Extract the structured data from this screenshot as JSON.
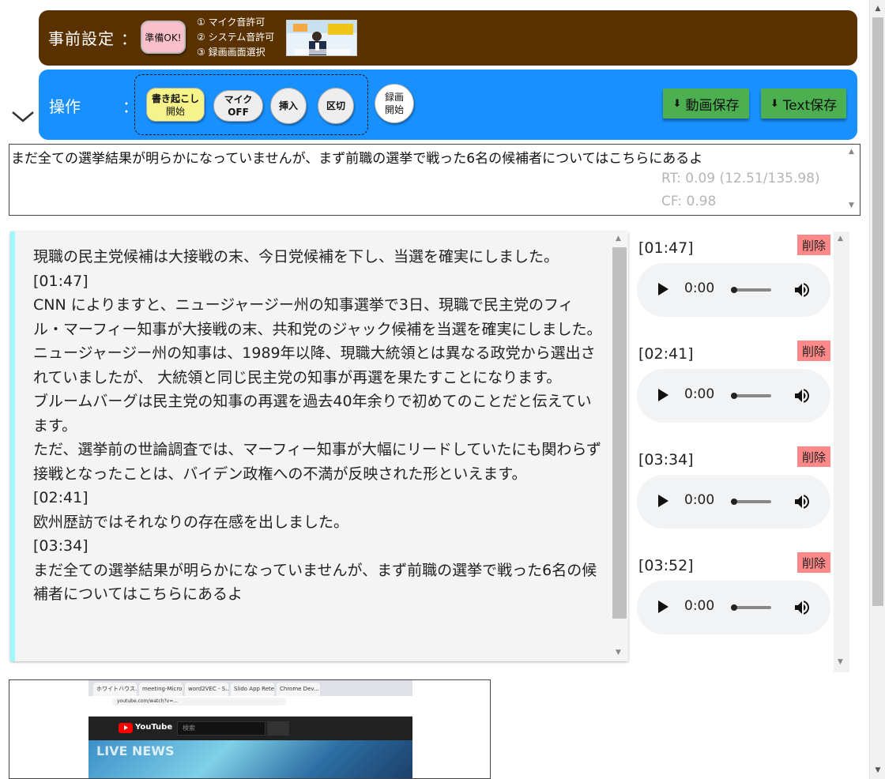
{
  "prep": {
    "title": "事前設定",
    "colon": "：",
    "ready_button": "準備OK!",
    "steps": [
      "① マイク音許可",
      "② システム音許可",
      "③ 録画画面選択"
    ]
  },
  "ops": {
    "title": "操作",
    "colon": "：",
    "transcribe_button": [
      "書き起こし",
      "開始"
    ],
    "mic_button": [
      "マイク",
      "OFF"
    ],
    "insert_button": "挿入",
    "split_button": "区切",
    "record_button": [
      "録画",
      "開始"
    ],
    "save_video_button": "動画保存",
    "save_text_button": "Text保存"
  },
  "live": {
    "text": "まだ全ての選挙結果が明らかになっていませんが、まず前職の選挙で戦った6名の候補者についてはこちらにあるよ",
    "rt": "RT: 0.09 (12.51/135.98)",
    "cf": "CF: 0.98"
  },
  "transcript": {
    "text": "現職の民主党候補は大接戦の末、今日党候補を下し、当選を確実にしました。\n[01:47]\nCNN によりますと、ニュージャージー州の知事選挙で3日、現職で民主党のフィル・マーフィー知事が大接戦の末、共和党のジャック候補を当選を確実にしました。\nニュージャージー州の知事は、1989年以降、現職大統領とは異なる政党から選出されていましたが、 大統領と同じ民主党の知事が再選を果たすことになります。\nブルームバーグは民主党の知事の再選を過去40年余りで初めてのことだと伝えています。\nただ、選挙前の世論調査では、マーフィー知事が大幅にリードしていたにも関わらず接戦となったことは、バイデン政権への不満が反映された形といえます。\n[02:41]\n欧州歴訪ではそれなりの存在感を出しました。\n[03:34]\nまだ全ての選挙結果が明らかになっていませんが、まず前職の選挙で戦った6名の候補者についてはこちらにあるよ"
  },
  "clips": [
    {
      "time": "[01:47]",
      "delete_label": "削除",
      "play_time": "0:00"
    },
    {
      "time": "[02:41]",
      "delete_label": "削除",
      "play_time": "0:00"
    },
    {
      "time": "[03:34]",
      "delete_label": "削除",
      "play_time": "0:00"
    },
    {
      "time": "[03:52]",
      "delete_label": "削除",
      "play_time": "0:00"
    }
  ],
  "screen_preview": {
    "tabs": [
      "ホワイトハウス...",
      "meeting-Micro...",
      "word2VEC - S...",
      "Slido App Rete...",
      "Chrome Dev..."
    ],
    "url": "youtube.com/watch?v=...",
    "youtube_label": "YouTube",
    "search_placeholder": "検索",
    "live_label": "LIVE NEWS"
  },
  "colors": {
    "prep_bar": "#5a3100",
    "ops_bar": "#1890ff",
    "ready_button": "#f9bfcb",
    "transcribe_button": "#f6f38a",
    "save_button": "#4caf50",
    "delete_button": "#ff8888",
    "transcript_accent": "#9ff7ff"
  }
}
